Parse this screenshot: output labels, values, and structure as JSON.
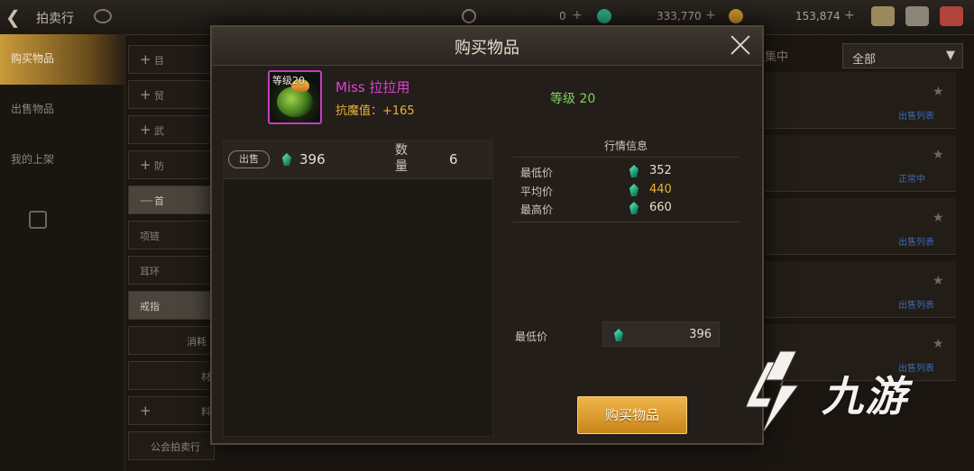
{
  "topbar": {
    "title": "拍卖行",
    "currency1": "0",
    "currency2": "333,770",
    "currency3": "153,874"
  },
  "sidebar": {
    "items": [
      {
        "label": "购买物品",
        "active": true
      },
      {
        "label": "出售物品",
        "active": false
      },
      {
        "label": "我的上架",
        "active": false
      }
    ]
  },
  "categories": {
    "items": [
      "目",
      "贸",
      "武",
      "防",
      "首",
      "项链",
      "耳环",
      "戒指",
      "消耗",
      "材",
      "料",
      "公会拍卖行"
    ]
  },
  "right_list": {
    "filter_label": "集中",
    "dropdown_value": "全部",
    "links": [
      "出售列表",
      "正常中",
      "出售列表",
      "出售列表",
      "出售列表"
    ]
  },
  "modal": {
    "title": "购买物品",
    "item": {
      "level_tag": "等级20",
      "name": "Miss 拉拉用",
      "attr": "抗魔值：+165",
      "level": "等级 20",
      "rarity_color": "#e040d8"
    },
    "listing": {
      "sell_label": "出售",
      "price": "396",
      "qty_label": "数量",
      "qty": "6"
    },
    "market": {
      "title": "行情信息",
      "rows": [
        {
          "label": "最低价",
          "value": "352"
        },
        {
          "label": "平均价",
          "value": "440"
        },
        {
          "label": "最高价",
          "value": "660"
        }
      ]
    },
    "min_price_label": "最低价",
    "min_price_value": "396",
    "buy_button": "购买物品"
  },
  "watermark": {
    "text": "九游"
  }
}
